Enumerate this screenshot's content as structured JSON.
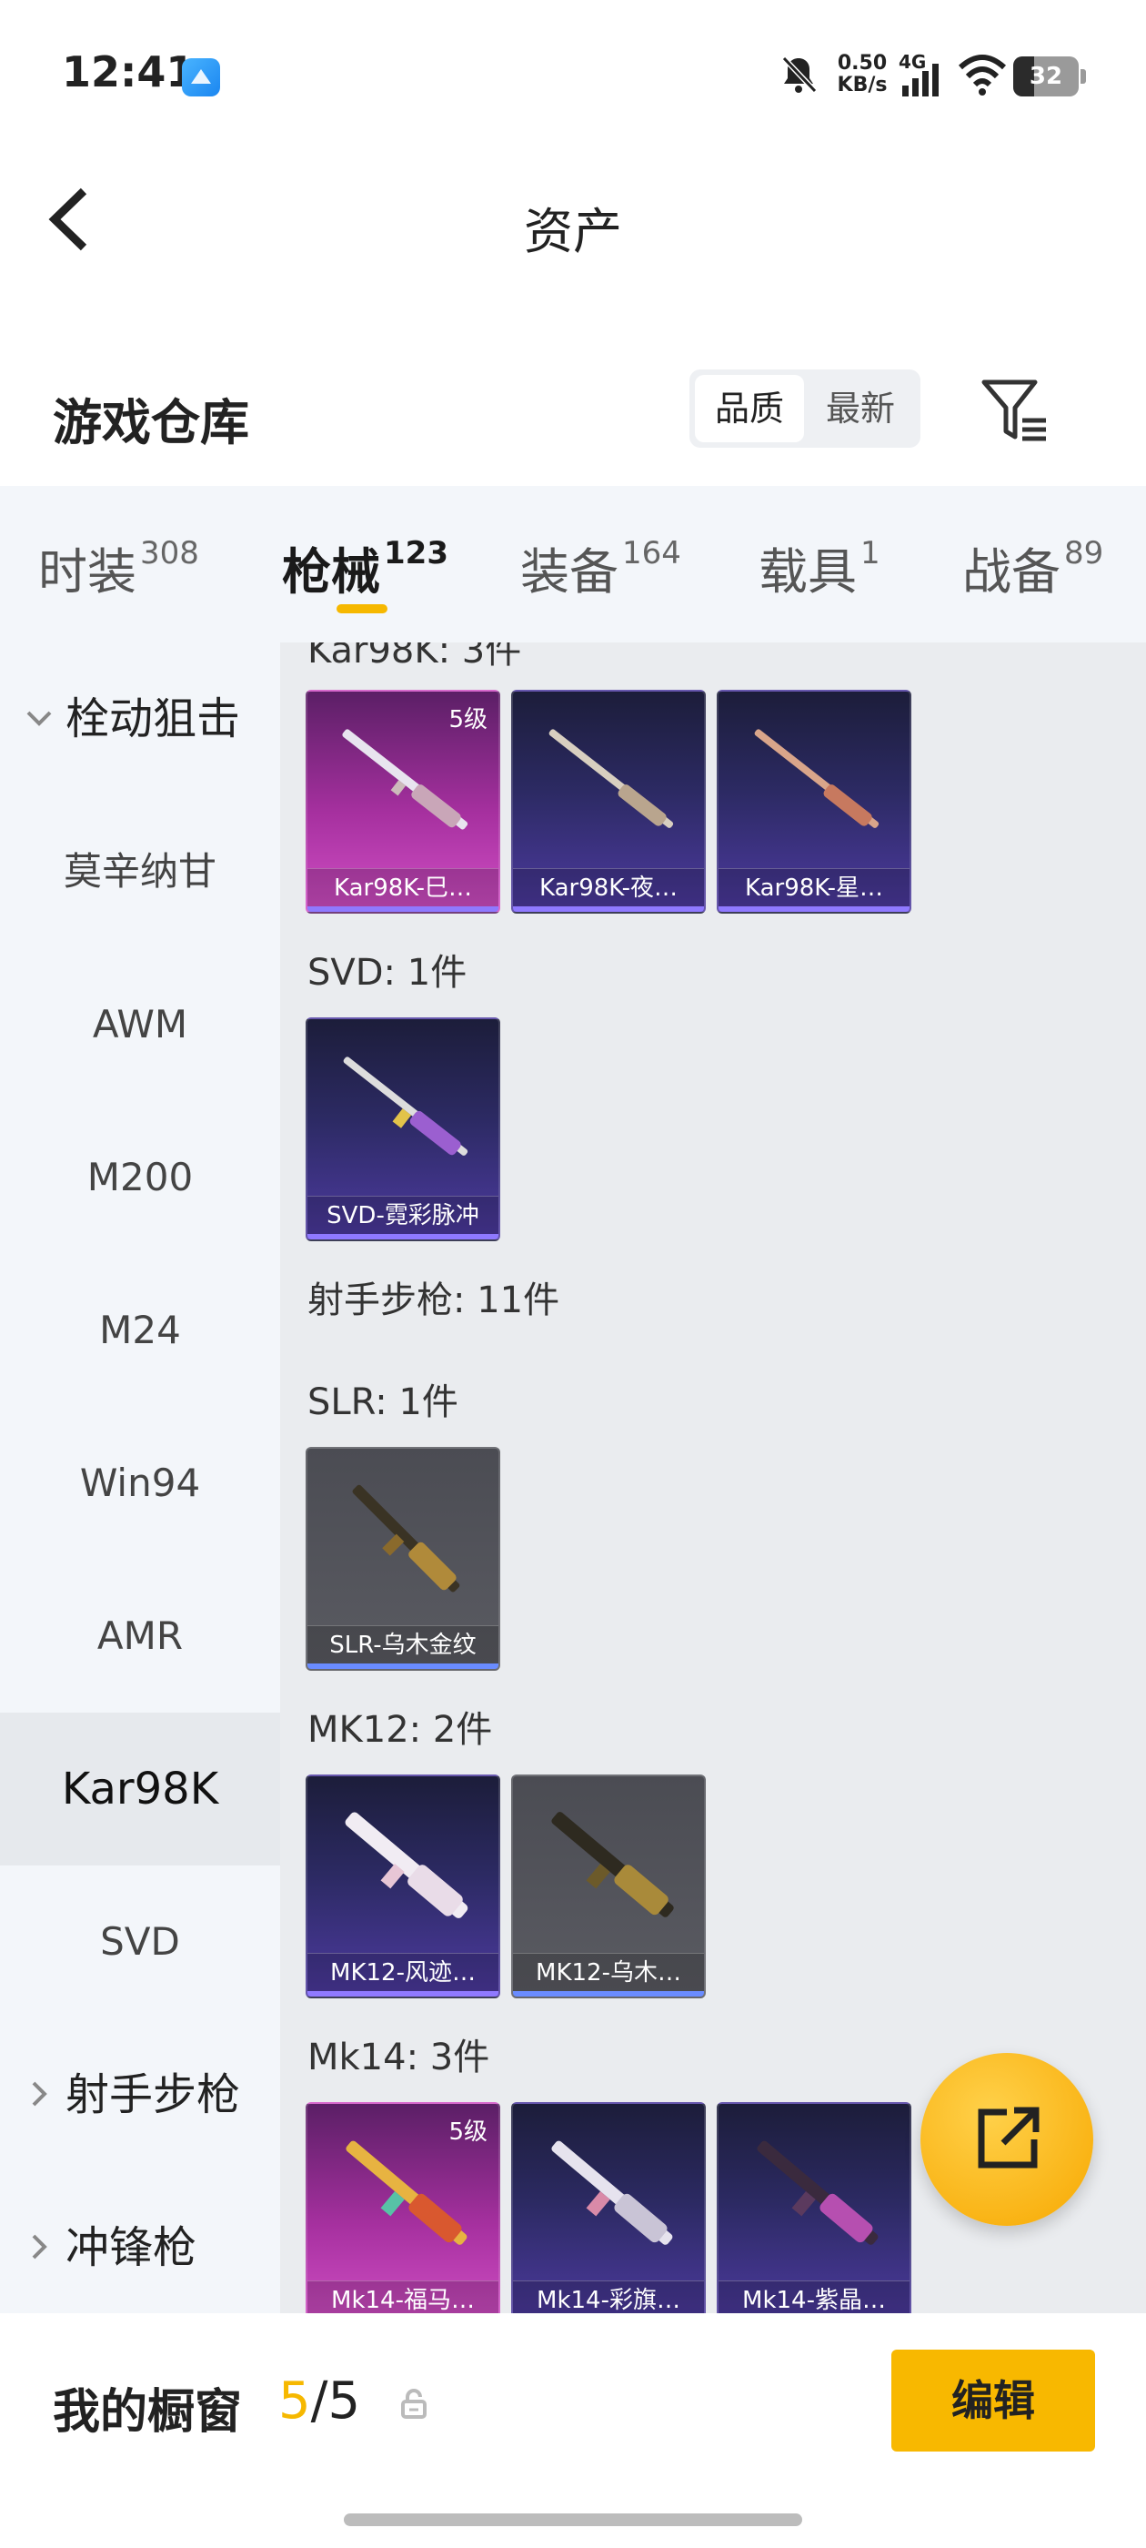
{
  "status_bar": {
    "time": "12:41",
    "net_speed_value": "0.50",
    "net_speed_unit": "KB/s",
    "network": "4G",
    "battery": "32",
    "battery_fraction": 0.32
  },
  "header": {
    "title": "资产"
  },
  "section": {
    "title": "游戏仓库",
    "sort_options": [
      "品质",
      "最新"
    ],
    "active_sort": "品质"
  },
  "tabs": [
    {
      "label": "时装",
      "count": "308"
    },
    {
      "label": "枪械",
      "count": "123",
      "active": true
    },
    {
      "label": "装备",
      "count": "164"
    },
    {
      "label": "载具",
      "count": "1"
    },
    {
      "label": "战备",
      "count": "89"
    }
  ],
  "sidebar": {
    "items": [
      {
        "label": "栓动狙击",
        "type": "group",
        "expanded": true
      },
      {
        "label": "莫辛纳甘"
      },
      {
        "label": "AWM"
      },
      {
        "label": "M200"
      },
      {
        "label": "M24"
      },
      {
        "label": "Win94"
      },
      {
        "label": "AMR"
      },
      {
        "label": "Kar98K",
        "active": true
      },
      {
        "label": "SVD"
      },
      {
        "label": "射手步枪",
        "type": "group",
        "expanded": false
      },
      {
        "label": "冲锋枪",
        "type": "group",
        "expanded": false
      }
    ]
  },
  "list": {
    "kar_header": "Kar98K: 3件",
    "kar": [
      {
        "name": "Kar98K-巳…",
        "rarity": "pink",
        "level": "5级"
      },
      {
        "name": "Kar98K-夜…",
        "rarity": "purple"
      },
      {
        "name": "Kar98K-星…",
        "rarity": "purple"
      }
    ],
    "svd_header": "SVD: 1件",
    "svd": [
      {
        "name": "SVD-霓彩脉冲",
        "rarity": "purple"
      }
    ],
    "marksman_header": "射手步枪: 11件",
    "slr_header": "SLR: 1件",
    "slr": [
      {
        "name": "SLR-乌木金纹",
        "rarity": "grey"
      }
    ],
    "mk12_header": "MK12: 2件",
    "mk12": [
      {
        "name": "MK12-风迹…",
        "rarity": "purple"
      },
      {
        "name": "MK12-乌木…",
        "rarity": "grey"
      }
    ],
    "mk14_header": "Mk14: 3件",
    "mk14": [
      {
        "name": "Mk14-福马…",
        "rarity": "pink",
        "level": "5级"
      },
      {
        "name": "Mk14-彩旗…",
        "rarity": "purple"
      },
      {
        "name": "Mk14-紫晶…",
        "rarity": "purple"
      }
    ]
  },
  "bottom": {
    "showcase_label": "我的橱窗",
    "showcase_current": "5",
    "showcase_total": "/5",
    "edit_label": "编辑"
  },
  "colors": {
    "accent": "#f6b800",
    "purple_card": "#2c2a63",
    "pink_card": "#a6309f",
    "grey_card": "#55565c"
  }
}
